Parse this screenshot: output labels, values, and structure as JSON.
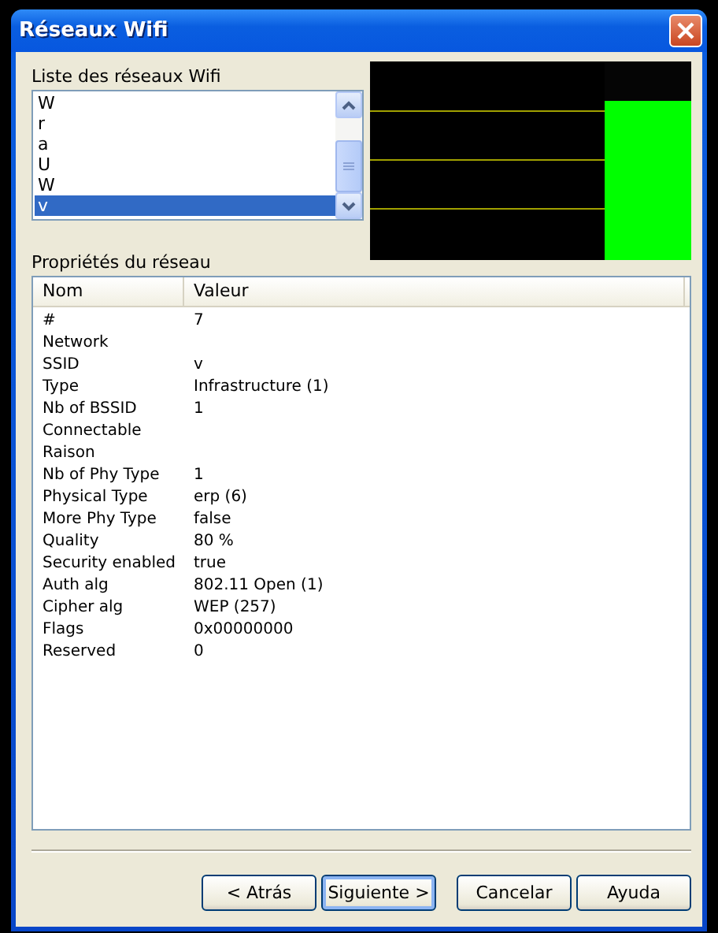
{
  "window": {
    "title": "Réseaux Wifi"
  },
  "network_list": {
    "label": "Liste des réseaux Wifi",
    "items": [
      {
        "label": "W",
        "selected": false
      },
      {
        "label": "r",
        "selected": false
      },
      {
        "label": "a",
        "selected": false
      },
      {
        "label": "U",
        "selected": false
      },
      {
        "label": "W",
        "selected": false
      },
      {
        "label": "v",
        "selected": true
      }
    ]
  },
  "signal_meter": {
    "level": 0.8
  },
  "properties": {
    "label": "Propriétés du réseau",
    "columns": [
      "Nom",
      "Valeur"
    ],
    "rows": [
      [
        "#",
        "7"
      ],
      [
        "Network",
        ""
      ],
      [
        "SSID",
        "v"
      ],
      [
        "Type",
        "Infrastructure (1)"
      ],
      [
        "Nb of BSSID",
        "1"
      ],
      [
        "Connectable",
        ""
      ],
      [
        "Raison",
        ""
      ],
      [
        "Nb of Phy Type",
        "1"
      ],
      [
        "Physical Type",
        "erp (6)"
      ],
      [
        "More Phy Type",
        "false"
      ],
      [
        "Quality",
        "80 %"
      ],
      [
        "Security enabled",
        "true"
      ],
      [
        "Auth alg",
        "802.11 Open (1)"
      ],
      [
        "Cipher alg",
        "WEP (257)"
      ],
      [
        "Flags",
        "0x00000000"
      ],
      [
        "Reserved",
        "0"
      ]
    ]
  },
  "buttons": [
    {
      "label": "< Atrás",
      "default": false
    },
    {
      "label": "Siguiente >",
      "default": true
    },
    {
      "label": "Cancelar",
      "default": false
    },
    {
      "label": "Ayuda",
      "default": false
    }
  ]
}
